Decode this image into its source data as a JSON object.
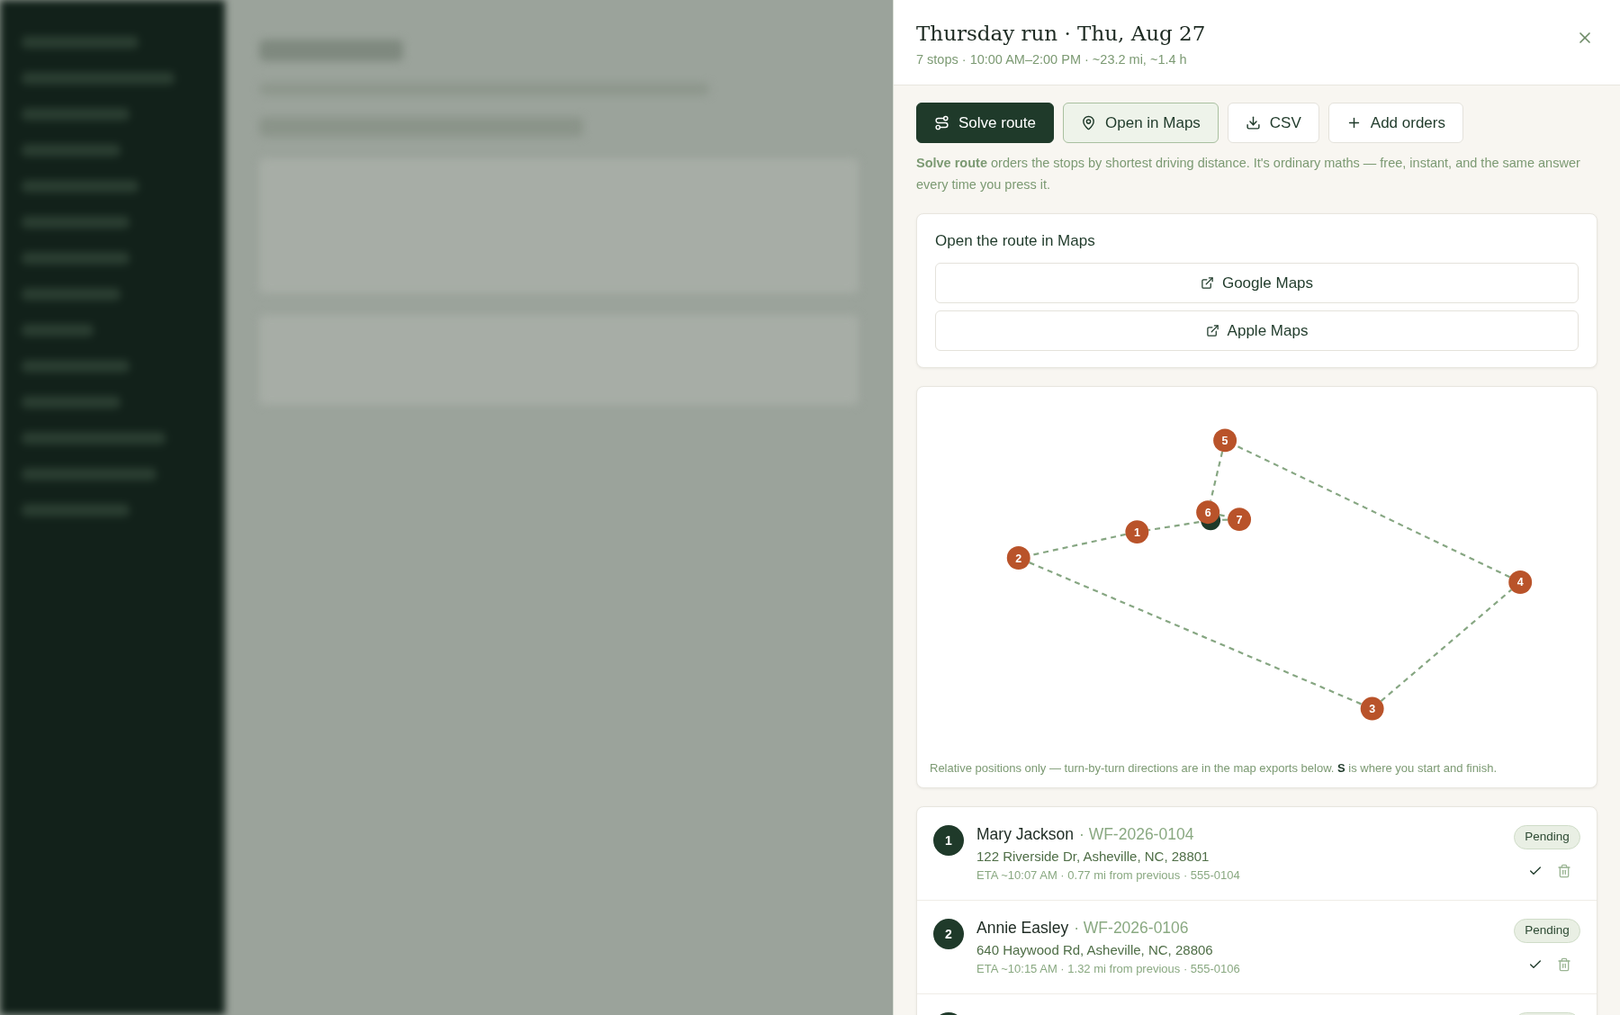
{
  "drawer": {
    "title": "Thursday run · Thu, Aug 27",
    "summary": "7 stops · 10:00 AM–2:00 PM · ~23.2 mi, ~1.4 h"
  },
  "actions": [
    {
      "kind": "primary",
      "label": "Solve route"
    },
    {
      "kind": "active",
      "label": "Open in Maps"
    },
    {
      "kind": "plain",
      "label": "CSV"
    },
    {
      "kind": "plain",
      "label": "Add orders"
    }
  ],
  "note": "**Solve route** orders the stops by shortest driving distance. It's ordinary maths — free, instant, and the same answer every time you press it.",
  "maps_card": {
    "title": "Open the route in Maps",
    "links": [
      "Google Maps",
      "Apple Maps"
    ]
  },
  "map": {
    "markers": [
      {
        "label": "1"
      },
      {
        "label": "2"
      },
      {
        "label": "3"
      },
      {
        "label": "4"
      },
      {
        "label": "5"
      },
      {
        "label": "6"
      },
      {
        "label": "7"
      }
    ],
    "caption": "Relative positions only — turn-by-turn directions are in the map exports below. **S** is where you start and finish."
  },
  "stops": [
    {
      "number": "1",
      "name": "Mary Jackson",
      "order_id": "· WF-2026-0104",
      "address": "122 Riverside Dr, Asheville, NC, 28801",
      "details": "ETA ~10:07 AM · 0.77 mi from previous · 555-0104",
      "status": "Pending"
    },
    {
      "number": "2",
      "name": "Annie Easley",
      "order_id": "· WF-2026-0106",
      "address": "640 Haywood Rd, Asheville, NC, 28806",
      "details": "ETA ~10:15 AM · 1.32 mi from previous · 555-0106",
      "status": "Pending"
    }
  ]
}
